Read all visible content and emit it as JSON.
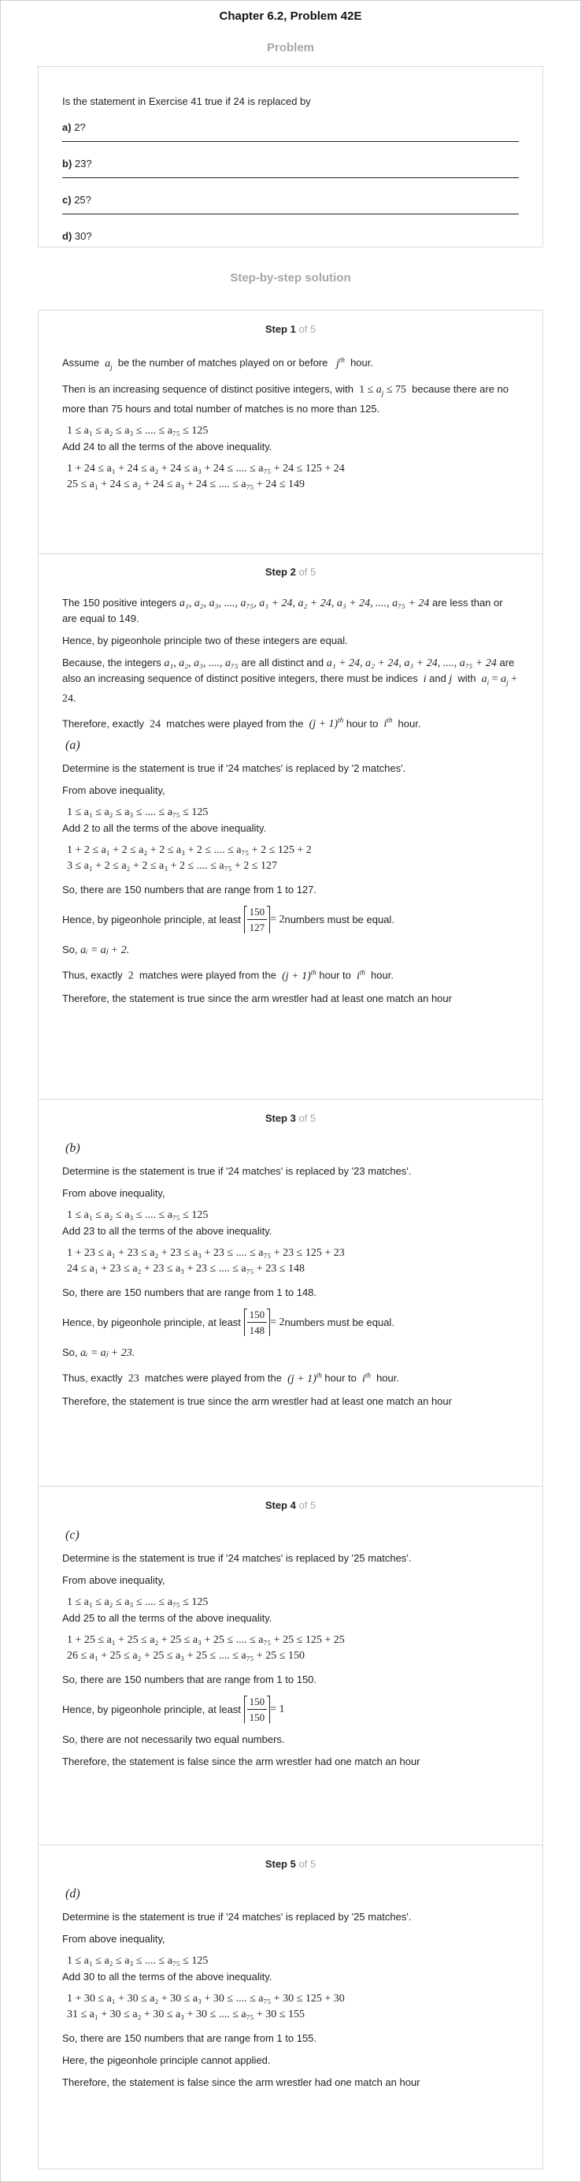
{
  "header": {
    "title": "Chapter 6.2, Problem 42E"
  },
  "problem": {
    "section_title": "Problem",
    "statement": "Is the statement in Exercise 41 true if 24 is replaced by",
    "options": [
      {
        "letter": "a)",
        "text": "2?"
      },
      {
        "letter": "b)",
        "text": "23?"
      },
      {
        "letter": "c)",
        "text": "25?"
      },
      {
        "letter": "d)",
        "text": "30?"
      }
    ]
  },
  "solution": {
    "section_title": "Step-by-step solution",
    "step_word": "Step",
    "of_word": "of",
    "total": "5",
    "steps": [
      {
        "num": "1",
        "assume_pre": "Assume",
        "assume_mid": "be the number of matches played on or before",
        "assume_post": "hour.",
        "seq_pre": "Then is an increasing sequence of distinct positive integers, with",
        "seq_post": "because there are no more than 75 hours and total number of matches is no more than 125.",
        "ineq": "1 ≤ a₁ ≤ a₂ ≤ a₃ ≤ .... ≤ a₇₅ ≤ 125",
        "add": "Add 24 to all the terms of the above inequality.",
        "eq1": "1 + 24 ≤ a₁ + 24 ≤ a₂ + 24 ≤ a₃ + 24 ≤ .... ≤ a₇₅ + 24 ≤ 125 + 24",
        "eq2": "25 ≤ a₁ + 24 ≤ a₂ + 24 ≤ a₃ + 24 ≤ .... ≤ a₇₅ + 24 ≤ 149"
      },
      {
        "num": "2",
        "p1_pre": "The 150 positive integers",
        "p1_math": "a₁, a₂, a₃, ...., a₇₅, a₁ + 24, a₂ + 24, a₃ + 24, ...., a₇₅ + 24",
        "p1_post": "are less than or are equal to 149.",
        "p2": "Hence, by pigeonhole principle two of these integers are equal.",
        "p3_pre": "Because, the integers",
        "p3_math1": "a₁, a₂, a₃, ...., a₇₅",
        "p3_mid": "are all distinct and",
        "p3_math2": "a₁ + 24, a₂ + 24, a₃ + 24, ...., a₇₅ + 24",
        "p3_post": "are also an increasing sequence of distinct positive integers, there must be indices",
        "p3_and": "and",
        "p3_with": "with",
        "p4_pre": "Therefore, exactly",
        "p4_num": "24",
        "p4_mid": "matches were played from the",
        "p4_hour": "hour to",
        "p4_post": "hour.",
        "case": "(a)",
        "c1": "Determine is the statement is true if '24 matches' is replaced by '2 matches'.",
        "c2": "From above inequality,",
        "ineq": "1 ≤ a₁ ≤ a₂ ≤ a₃ ≤ .... ≤ a₇₅ ≤ 125",
        "add": "Add 2 to all the terms of the above inequality.",
        "eq1": "1 + 2 ≤ a₁ + 2 ≤ a₂ + 2 ≤ a₃ + 2 ≤ .... ≤ a₇₅ + 2 ≤ 125 + 2",
        "eq2": "3 ≤ a₁ + 2 ≤ a₂ + 2 ≤ a₃ + 2 ≤ .... ≤ a₇₅ + 2 ≤ 127",
        "range": "So, there are 150 numbers that are range from 1 to 127.",
        "pig_pre": "Hence, by pigeonhole principle, at least",
        "frac_num": "150",
        "frac_den": "127",
        "frac_eq": "= 2",
        "pig_post": "numbers must be equal.",
        "so_pre": "So,",
        "so_math": "aᵢ = aⱼ + 2.",
        "thus_pre": "Thus, exactly",
        "thus_num": "2",
        "thus_mid": "matches were played from the",
        "thus_hour": "hour to",
        "thus_post": "hour.",
        "concl": "Therefore, the statement is true since the arm wrestler had at least one match an hour"
      },
      {
        "num": "3",
        "case": "(b)",
        "c1": "Determine is the statement is true if '24 matches' is replaced by '23 matches'.",
        "c2": "From above inequality,",
        "ineq": "1 ≤ a₁ ≤ a₂ ≤ a₃ ≤ .... ≤ a₇₅ ≤ 125",
        "add": "Add 23 to all the terms of the above inequality.",
        "eq1": "1 + 23 ≤ a₁ + 23 ≤ a₂ + 23 ≤ a₃ + 23 ≤ .... ≤ a₇₅ + 23 ≤ 125 + 23",
        "eq2": "24 ≤ a₁ + 23 ≤ a₂ + 23 ≤ a₃ + 23 ≤ .... ≤ a₇₅ + 23 ≤ 148",
        "range": "So, there are 150 numbers that are range from 1 to 148.",
        "pig_pre": "Hence, by pigeonhole principle, at least",
        "frac_num": "150",
        "frac_den": "148",
        "frac_eq": "= 2",
        "pig_post": "numbers must be equal.",
        "so_pre": "So,",
        "so_math": "aᵢ = aⱼ + 23.",
        "thus_pre": "Thus, exactly",
        "thus_num": "23",
        "thus_mid": "matches were played from the",
        "thus_hour": "hour to",
        "thus_post": "hour.",
        "concl": "Therefore, the statement is true since the arm wrestler had at least one match an hour"
      },
      {
        "num": "4",
        "case": "(c)",
        "c1": "Determine is the statement is true if '24 matches' is replaced by '25 matches'.",
        "c2": "From above inequality,",
        "ineq": "1 ≤ a₁ ≤ a₂ ≤ a₃ ≤ .... ≤ a₇₅ ≤ 125",
        "add": "Add 25 to all the terms of the above inequality.",
        "eq1": "1 + 25 ≤ a₁ + 25 ≤ a₂ + 25 ≤ a₃ + 25 ≤ .... ≤ a₇₅ + 25 ≤ 125 + 25",
        "eq2": "26 ≤ a₁ + 25 ≤ a₂ + 25 ≤ a₃ + 25 ≤ .... ≤ a₇₅ + 25 ≤ 150",
        "range": "So, there are 150 numbers that are range from 1 to 150.",
        "pig_pre": "Hence, by pigeonhole principle, at least",
        "frac_num": "150",
        "frac_den": "150",
        "frac_eq": "= 1",
        "p_not": "So, there are not necessarily two equal numbers.",
        "concl": "Therefore, the statement is false since the arm wrestler had one match an hour"
      },
      {
        "num": "5",
        "case": "(d)",
        "c1": "Determine is the statement is true if '24 matches' is replaced by '25 matches'.",
        "c2": "From above inequality,",
        "ineq": "1 ≤ a₁ ≤ a₂ ≤ a₃ ≤ .... ≤ a₇₅ ≤ 125",
        "add": "Add 30 to all the terms of the above inequality.",
        "eq1": "1 + 30 ≤ a₁ + 30 ≤ a₂ + 30 ≤ a₃ + 30 ≤ .... ≤ a₇₅ + 30 ≤ 125 + 30",
        "eq2": "31 ≤ a₁ + 30 ≤ a₂ + 30 ≤ a₃ + 30 ≤ .... ≤ a₇₅ + 30 ≤ 155",
        "range": "So, there are 150 numbers that are range from 1 to 155.",
        "p_not": "Here, the pigeonhole principle cannot applied.",
        "concl": "Therefore, the statement is false since the arm wrestler had one match an hour"
      }
    ]
  }
}
